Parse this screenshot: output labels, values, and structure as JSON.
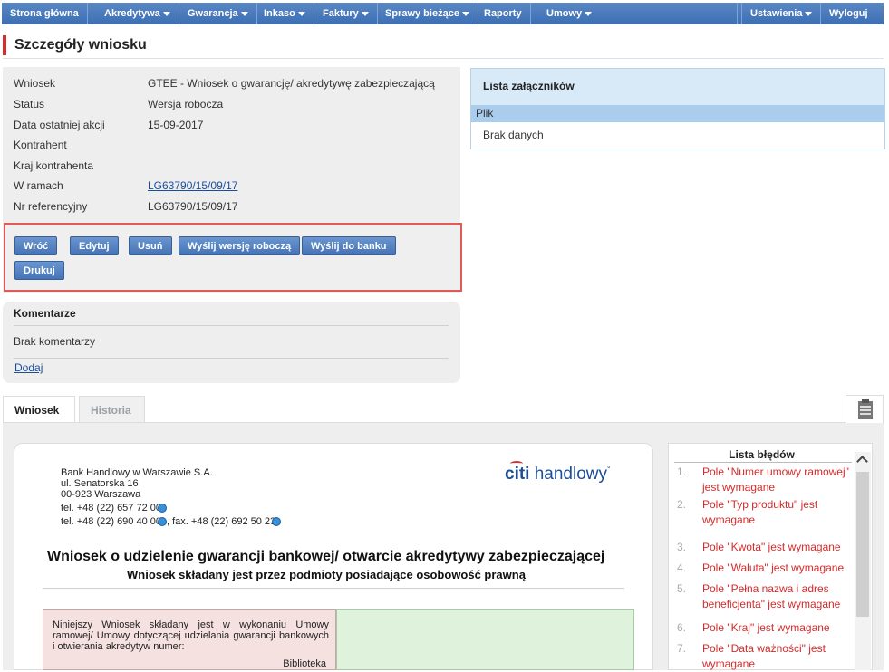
{
  "nav": {
    "items": [
      {
        "label": "Strona główna",
        "dropdown": false
      },
      {
        "label": "Akredytywa",
        "dropdown": true
      },
      {
        "label": "Gwarancja",
        "dropdown": true
      },
      {
        "label": "Inkaso",
        "dropdown": true
      },
      {
        "label": "Faktury",
        "dropdown": true
      },
      {
        "label": "Sprawy bieżące",
        "dropdown": true
      },
      {
        "label": "Raporty",
        "dropdown": false
      },
      {
        "label": "Umowy",
        "dropdown": true
      }
    ],
    "right": [
      {
        "label": "Ustawienia",
        "dropdown": true
      },
      {
        "label": "Wyloguj",
        "dropdown": false
      }
    ]
  },
  "page": {
    "title": "Szczegóły wniosku"
  },
  "details": {
    "rows": [
      {
        "label": "Wniosek",
        "value": "GTEE - Wniosek o gwarancję/ akredytywę zabezpieczającą"
      },
      {
        "label": "Status",
        "value": "Wersja robocza"
      },
      {
        "label": "Data ostatniej akcji",
        "value": "15-09-2017"
      },
      {
        "label": "Kontrahent",
        "value": ""
      },
      {
        "label": "Kraj kontrahenta",
        "value": ""
      },
      {
        "label": "W ramach",
        "value": "LG63790/15/09/17"
      },
      {
        "label": "Nr referencyjny",
        "value": "LG63790/15/09/17"
      }
    ]
  },
  "actions": {
    "back": "Wróć",
    "edit": "Edytuj",
    "delete": "Usuń",
    "send_draft": "Wyślij wersję roboczą",
    "send_bank": "Wyślij do banku",
    "print": "Drukuj"
  },
  "comments": {
    "title": "Komentarze",
    "empty": "Brak komentarzy",
    "add": "Dodaj"
  },
  "attachments": {
    "title": "Lista załączników",
    "column": "Plik",
    "empty": "Brak danych"
  },
  "tabs": {
    "active": "Wniosek",
    "inactive": "Historia"
  },
  "document": {
    "bank_name": "Bank Handlowy w Warszawie S.A.",
    "street": "ul. Senatorska 16",
    "city": "00-923 Warszawa",
    "tel1": "tel. +48 (22) 657 72 00",
    "tel2": "tel. +48 (22) 690 40 00",
    "fax": ", fax. +48 (22) 692 50 23",
    "logo_citi": "citi",
    "logo_handlowy": " handlowy",
    "title": "Wniosek o udzielenie gwarancji bankowej/ otwarcie akredytywy zabezpieczającej",
    "subtitle": "Wniosek składany jest przez podmioty posiadające osobowość prawną",
    "agreement_text": "Niniejszy Wniosek składany jest w wykonaniu Umowy ramowej/ Umowy dotyczącej udzielania gwarancji bankowych i otwierania akredytyw numer:",
    "biblioteka": "Biblioteka"
  },
  "errors": {
    "title": "Lista błędów",
    "items": [
      {
        "n": "1.",
        "text": "Pole \"Numer umowy ramowej\" jest wymagane"
      },
      {
        "n": "2.",
        "text": "Pole \"Typ produktu\" jest wymagane"
      },
      {
        "n": "3.",
        "text": "Pole \"Kwota\" jest wymagane"
      },
      {
        "n": "4.",
        "text": "Pole \"Waluta\" jest wymagane"
      },
      {
        "n": "5.",
        "text": "Pole \"Pełna nazwa i adres beneficjenta\" jest wymagane"
      },
      {
        "n": "6.",
        "text": "Pole \"Kraj\" jest wymagane"
      },
      {
        "n": "7.",
        "text": "Pole \"Data ważności\" jest wymagane"
      }
    ]
  }
}
